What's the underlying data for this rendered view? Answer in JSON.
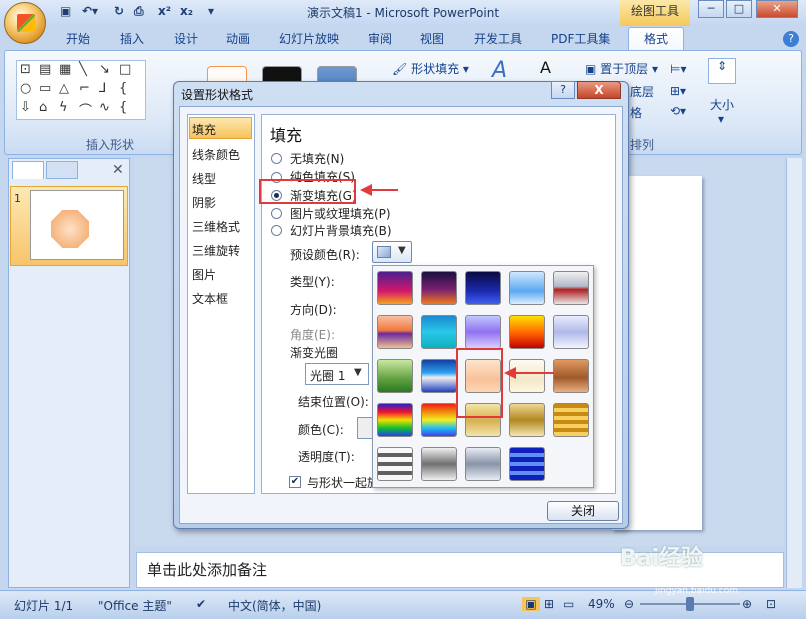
{
  "window": {
    "title": "演示文稿1 - Microsoft PowerPoint",
    "contextual_tab": "绘图工具",
    "qat_items": [
      "x²",
      "x₂"
    ]
  },
  "tabs": [
    "开始",
    "插入",
    "设计",
    "动画",
    "幻灯片放映",
    "审阅",
    "视图",
    "开发工具",
    "PDF工具集",
    "格式"
  ],
  "ribbon": {
    "insert_shapes_label": "插入形状",
    "shape_fill": "形状填充",
    "bring_front": "置于顶层",
    "send_back": "底层",
    "selection": "格",
    "arrange_label": "排列",
    "size_label": "大小"
  },
  "slide_pane": {
    "slide_number": "1"
  },
  "notes_placeholder": "单击此处添加备注",
  "status": {
    "slide": "幻灯片 1/1",
    "theme": "\"Office 主题\"",
    "language": "中文(简体，中国)",
    "zoom": "49%"
  },
  "dialog": {
    "title": "设置形状格式",
    "categories": [
      "填充",
      "线条颜色",
      "线型",
      "阴影",
      "三维格式",
      "三维旋转",
      "图片",
      "文本框"
    ],
    "panel_title": "填充",
    "fill_options": [
      "无填充(N)",
      "纯色填充(S)",
      "渐变填充(G)",
      "图片或纹理填充(P)",
      "幻灯片背景填充(B)"
    ],
    "selected_fill": "渐变填充(G)",
    "preset_color_label": "预设颜色(R):",
    "type_label": "类型(Y):",
    "direction_label": "方向(D):",
    "angle_label": "角度(E):",
    "gradient_stops_label": "渐变光圈",
    "stop_value": "光圈 1",
    "end_position_label": "结束位置(O):",
    "color_label": "颜色(C):",
    "transparency_label": "透明度(T):",
    "rotate_with_shape": "与形状一起旋",
    "close_button": "关闭",
    "help": "?",
    "close_x": "X"
  },
  "gradient_presets": [
    [
      "linear-gradient(#4b1f8f,#d4186b 60%,#f6a51a)",
      "linear-gradient(#1b1040,#7a2070 55%,#f07a1a)",
      "linear-gradient(#0a0a40,#1a2ab0 60%,#4060f0)",
      "linear-gradient(#cfe6ff,#5aa8f0 60%,#dceeff)",
      "linear-gradient(#f0f0f0,#b0b8c8 45%,#b02020 55%,#e8e8e8)"
    ],
    [
      "linear-gradient(#f8c0a0,#f07840 45%,#6a2aa0 55%,#f0c090)",
      "linear-gradient(#1a8ad0,#28c8e8 50%,#10b0c0)",
      "linear-gradient(#c0c8ff,#9070f0 50%,#d8d0ff)",
      "linear-gradient(#ffe000,#ff6000 55%,#c00000)",
      "linear-gradient(#e8ecff,#b0b8e8 50%,#f0f4ff)"
    ],
    [
      "linear-gradient(#c8e8a0,#60a040 60%,#2a7a20)",
      "linear-gradient(#1040a0,#30a0f0 40%,#f0f0f0 55%,#2040c0)",
      "linear-gradient(#fde4cc,#f8c29a 60%,#fdd6b4)",
      "linear-gradient(#fdfbf0,#f3e7c8 60%,#fdf6e0)",
      "linear-gradient(#e09a60,#a0582a 55%,#e8b080)"
    ],
    [
      "linear-gradient(#3020c0,#f01030 25%,#f0e000 50%,#10c030 75%,#2040f0)",
      "linear-gradient(#f02010,#f0a010 30%,#f0f020 50%,#20c0f0 75%,#4040f0)",
      "linear-gradient(#f4e6a8,#d4b050 50%,#f4e6a8)",
      "linear-gradient(#f0d890,#b08820 50%,#f6e6b0)",
      "repeating-linear-gradient(#c88a10 0 4px,#f6d060 4px 8px)"
    ],
    [
      "repeating-linear-gradient(#f8f8f8 0 5px,#606060 5px 9px)",
      "linear-gradient(#f0f0f0,#707070 50%,#f0f0f0)",
      "linear-gradient(#e8ecf4,#8894a8 50%,#e8ecf4)",
      "repeating-linear-gradient(#1020c0 0 5px,#6090f0 5px 9px)"
    ]
  ],
  "watermark": "Bai经验",
  "watermark_sub": "jingyan.baidu.com"
}
